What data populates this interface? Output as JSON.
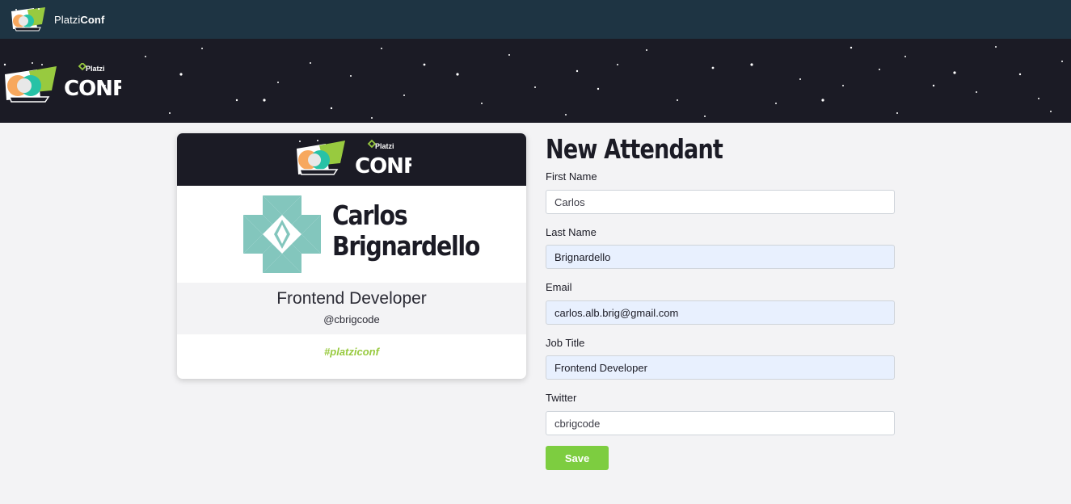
{
  "navbar": {
    "brand_light": "Platzi",
    "brand_bold": "Conf"
  },
  "hero": {
    "logo_small": "Platzi",
    "logo_big": "CONF"
  },
  "badge": {
    "header_logo_small": "Platzi",
    "header_logo_big": "CONF",
    "first_name": "Carlos",
    "last_name": "Brignardello",
    "job_title": "Frontend Developer",
    "twitter": "@cbrigcode",
    "hashtag": "#platziconf"
  },
  "form": {
    "title": "New Attendant",
    "fields": [
      {
        "label": "First Name",
        "value": "Carlos",
        "autofilled": false
      },
      {
        "label": "Last Name",
        "value": "Brignardello",
        "autofilled": true
      },
      {
        "label": "Email",
        "value": "carlos.alb.brig@gmail.com",
        "autofilled": true
      },
      {
        "label": "Job Title",
        "value": "Frontend Developer",
        "autofilled": true
      },
      {
        "label": "Twitter",
        "value": "cbrigcode",
        "autofilled": false
      }
    ],
    "save_label": "Save"
  },
  "icons": {
    "logo": "platziconf-logo-icon",
    "avatar": "identicon-avatar"
  },
  "colors": {
    "navbar": "#1e3443",
    "hero": "#1b1b25",
    "accent_green": "#7dcd40",
    "hashtag": "#98ca3f",
    "autofill": "#e8f0fe"
  }
}
